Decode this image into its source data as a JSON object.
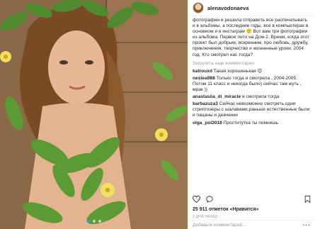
{
  "post": {
    "username": "alenavodonaeva",
    "caption": "фотографии и решила отправить все распечатывать и в альбомы, а последние годы, все в компьютерах в основном и в инстаграм 🙂 Вот вам три фотографии из альбома. Первое лето на Дом-2. Время, когда этот проект был добрым, искренним, про любовь, дружбу, приключения, творчество и жизненные уроки. 2004 год. Кто смотрел нас тогда?",
    "load_more": "Загрузить еще комментарии",
    "comments": [
      {
        "user": "katrouxd",
        "text": "Такая хорошенькая 😍"
      },
      {
        "user": "nestea988",
        "text": "Только тогда и смотрела , 2004-2005. Потом 11 класс и некогда было) сейчас там жуть , мрак ))"
      },
      {
        "user": "anastasiia_di_miracle",
        "text": "я смотрела тогда"
      },
      {
        "user": "barbazuza3",
        "text": "Сейчас невозможно смотреть,одни стриптизеры с шалавами,раньше естественные были и пацаны и девченки"
      },
      {
        "user": "olga_pol2018",
        "text": "Проститутка ты помнишь"
      }
    ],
    "likes": "25 911 отметок «Нравится»",
    "timestamp": "2 ДНЯ НАЗАД",
    "add_comment_placeholder": "Добавьте комментарий...",
    "more_options": "···"
  },
  "icons": [
    "heart-icon",
    "comment-icon",
    "bookmark-icon"
  ],
  "colors": {
    "accent": "#3897f0",
    "text": "#262626",
    "muted": "#999999"
  }
}
